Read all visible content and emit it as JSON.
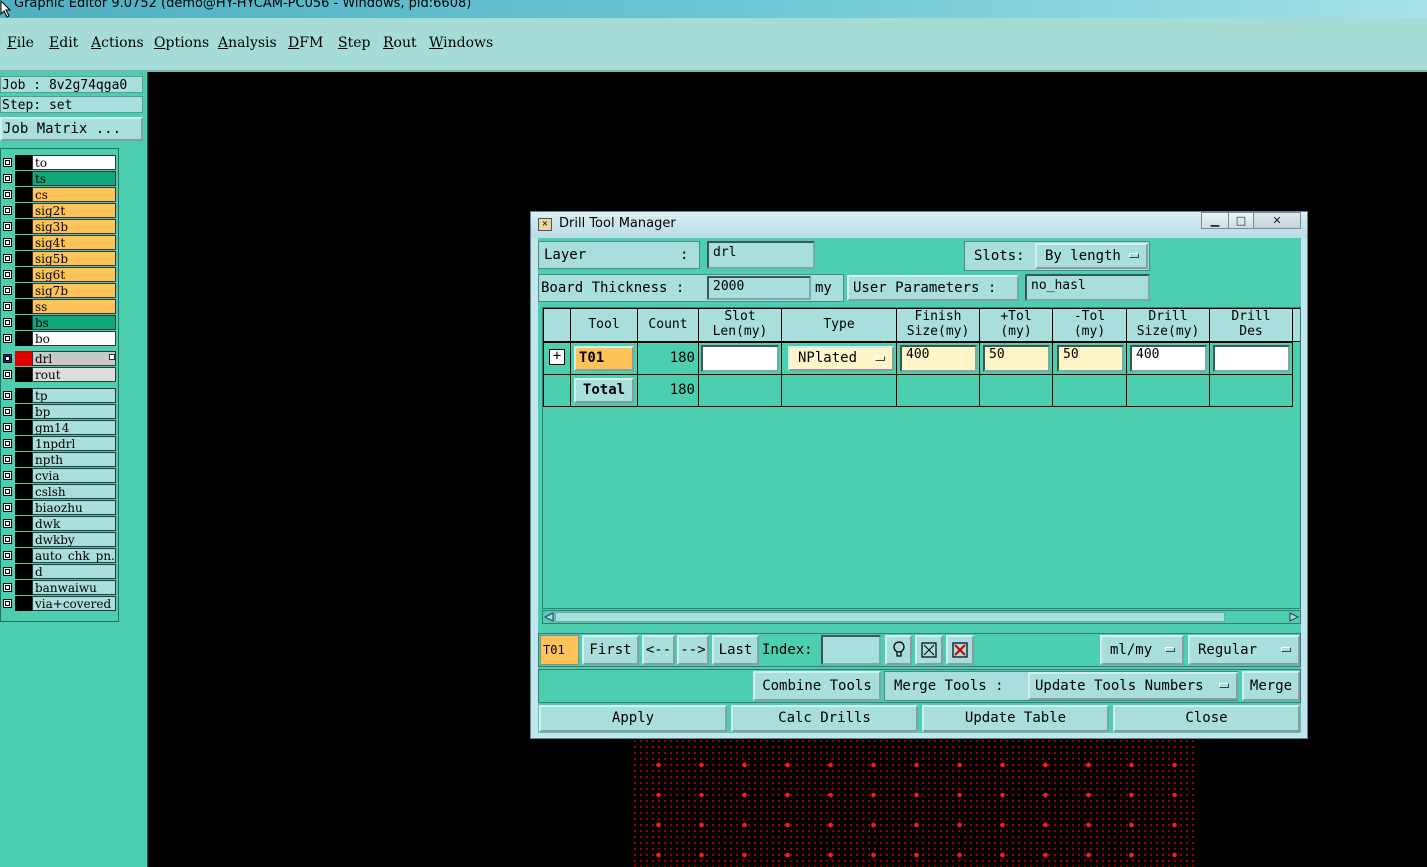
{
  "window": {
    "title": "Graphic Editor 9.0752 (demo@HY-HYCAM-PC056 - Windows, pid:6608)"
  },
  "menu": [
    "File",
    "Edit",
    "Actions",
    "Options",
    "Analysis",
    "DFM",
    "Step",
    "Rout",
    "Windows"
  ],
  "left": {
    "job": "Job : 8v2g74qga0",
    "step": "Step: set",
    "job_matrix": "Job Matrix ...",
    "layers": [
      {
        "name": "to",
        "color": "#ffffff"
      },
      {
        "name": "ts",
        "color": "#11a87a"
      },
      {
        "name": "cs",
        "color": "#ffc35a"
      },
      {
        "name": "sig2t",
        "color": "#ffc35a"
      },
      {
        "name": "sig3b",
        "color": "#ffc35a"
      },
      {
        "name": "sig4t",
        "color": "#ffc35a"
      },
      {
        "name": "sig5b",
        "color": "#ffc35a"
      },
      {
        "name": "sig6t",
        "color": "#ffc35a"
      },
      {
        "name": "sig7b",
        "color": "#ffc35a"
      },
      {
        "name": "ss",
        "color": "#ffc35a"
      },
      {
        "name": "bs",
        "color": "#11a87a"
      },
      {
        "name": "bo",
        "color": "#ffffff"
      },
      {
        "name": "drl",
        "color": "#c9c9c9",
        "active": true
      },
      {
        "name": "rout",
        "color": "#dddddd"
      },
      {
        "name": "tp",
        "color": "#a8dedb"
      },
      {
        "name": "bp",
        "color": "#a8dedb"
      },
      {
        "name": "gm14",
        "color": "#a8dedb"
      },
      {
        "name": "1npdrl",
        "color": "#a8dedb"
      },
      {
        "name": "npth",
        "color": "#a8dedb"
      },
      {
        "name": "cvia",
        "color": "#a8dedb"
      },
      {
        "name": "cslsh",
        "color": "#a8dedb"
      },
      {
        "name": "biaozhu",
        "color": "#a8dedb"
      },
      {
        "name": "dwk",
        "color": "#a8dedb"
      },
      {
        "name": "dwkby",
        "color": "#a8dedb"
      },
      {
        "name": "auto_chk_pn.",
        "color": "#a8dedb"
      },
      {
        "name": "d",
        "color": "#a8dedb"
      },
      {
        "name": "banwaiwu",
        "color": "#a8dedb"
      },
      {
        "name": "via+covered",
        "color": "#a8dedb"
      }
    ]
  },
  "dialog": {
    "title": "Drill Tool Manager",
    "layer_label": "Layer",
    "layer_colon": ":",
    "layer_value": "drl",
    "slots_label": "Slots:",
    "slots_value": "By length",
    "board_thickness_label": "Board Thickness :",
    "board_thickness_value": "2000",
    "board_thickness_unit": "my",
    "user_params_label": "User Parameters :",
    "user_params_value": "no_hasl",
    "columns": [
      {
        "key": "tool",
        "l1": "Tool",
        "l2": ""
      },
      {
        "key": "count",
        "l1": "Count",
        "l2": ""
      },
      {
        "key": "slot",
        "l1": "Slot",
        "l2": "Len(my)"
      },
      {
        "key": "type",
        "l1": "Type",
        "l2": ""
      },
      {
        "key": "finish",
        "l1": "Finish",
        "l2": "Size(my)"
      },
      {
        "key": "ptol",
        "l1": "+Tol",
        "l2": "(my)"
      },
      {
        "key": "mtol",
        "l1": "-Tol",
        "l2": "(my)"
      },
      {
        "key": "drill",
        "l1": "Drill",
        "l2": "Size(my)"
      },
      {
        "key": "des",
        "l1": "Drill",
        "l2": "Des"
      }
    ],
    "row": {
      "tool": "T01",
      "count": "180",
      "slot_len": "",
      "type": "NPlated",
      "finish_size": "400",
      "plus_tol": "50",
      "minus_tol": "50",
      "drill_size": "400",
      "drill_des": ""
    },
    "total": {
      "label": "Total",
      "count": "180"
    },
    "nav": {
      "current": "T01",
      "first": "First",
      "prev": "<--",
      "next": "-->",
      "last": "Last",
      "index_label": "Index:",
      "index_value": "",
      "units": "ml/my",
      "mode": "Regular"
    },
    "combine_tools": "Combine Tools",
    "merge_tools_label": "Merge Tools :",
    "merge_tools_value": "Update Tools Numbers",
    "merge": "Merge",
    "actions": [
      "Apply",
      "Calc Drills",
      "Update Table",
      "Close"
    ]
  }
}
